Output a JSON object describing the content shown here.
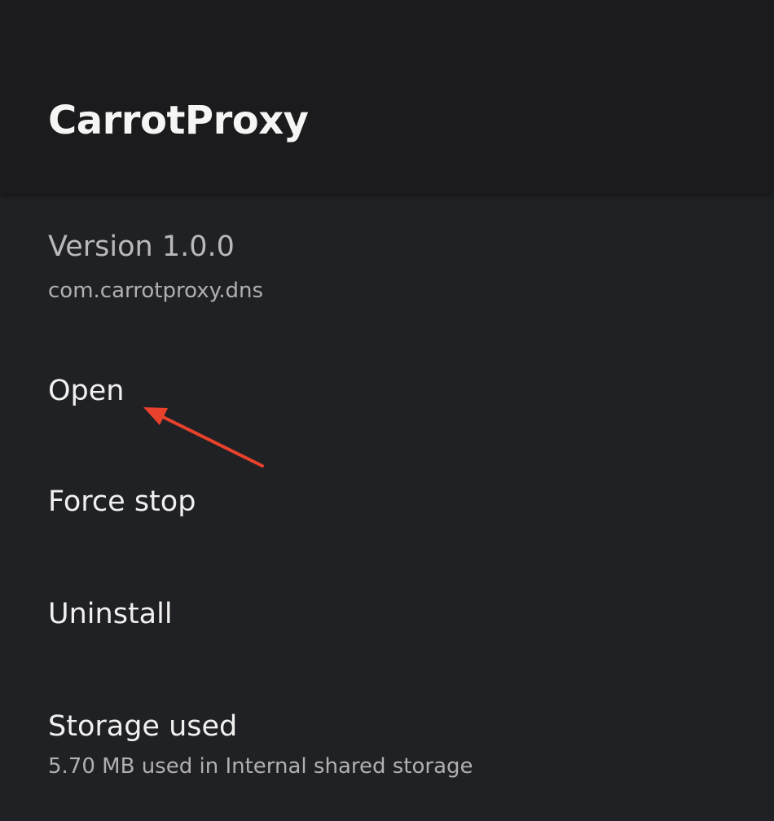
{
  "app": {
    "title": "CarrotProxy",
    "version": "Version 1.0.0",
    "package": "com.carrotproxy.dns"
  },
  "menu": {
    "open_label": "Open",
    "force_stop_label": "Force stop",
    "uninstall_label": "Uninstall",
    "storage_label": "Storage used",
    "storage_value": "5.70 MB used in Internal shared storage"
  },
  "annotation": {
    "arrow_color": "#e8412c",
    "arrow_icon": "arrow-annotation-icon"
  },
  "colors": {
    "background": "#202124",
    "header_background": "#1b1b1d"
  }
}
